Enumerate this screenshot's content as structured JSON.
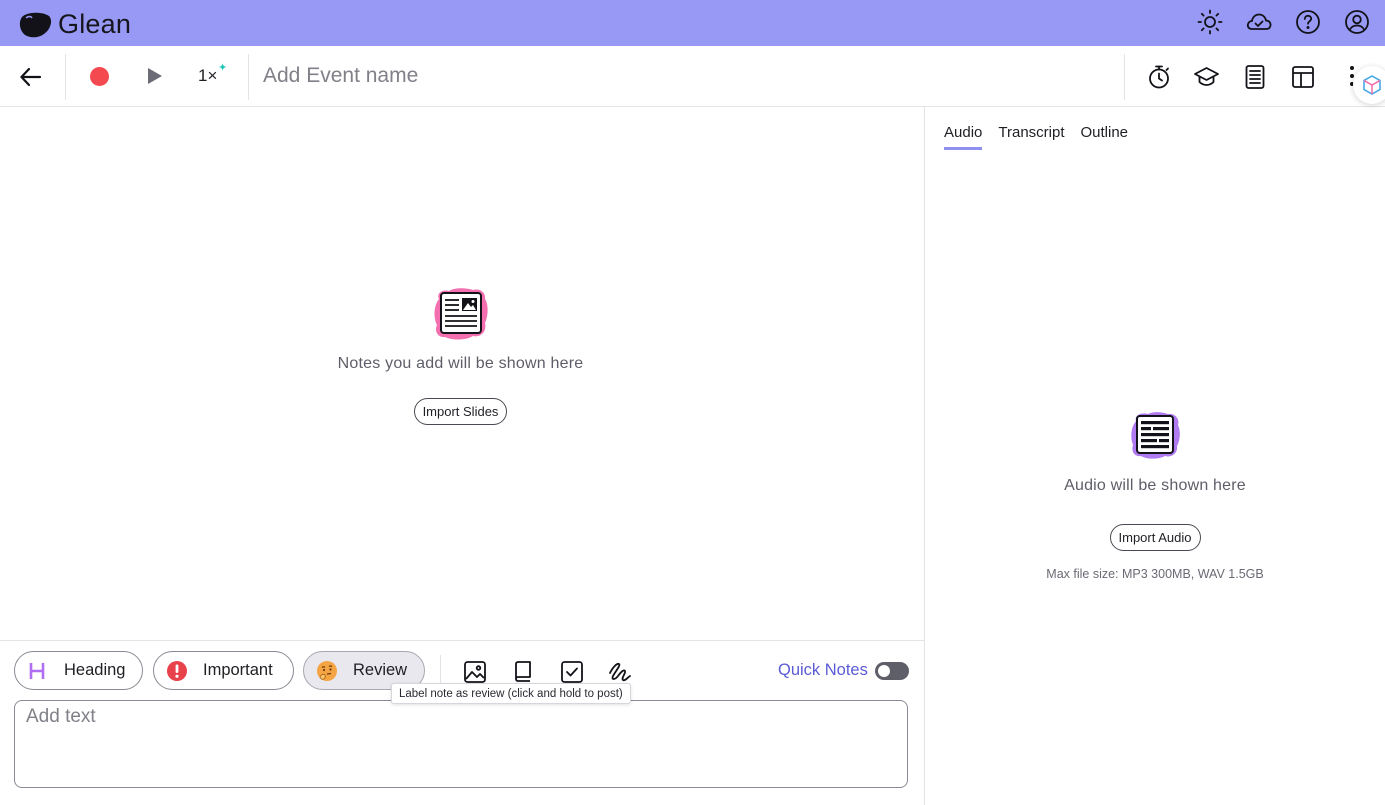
{
  "app": {
    "name": "Glean"
  },
  "topbar": {
    "icons": [
      "sun-icon",
      "cloud-icon",
      "help-icon",
      "account-icon"
    ]
  },
  "toolbar": {
    "speed": "1×",
    "event_placeholder": "Add Event name",
    "right_icons": [
      "timer-icon",
      "graduation-cap-icon",
      "document-icon",
      "layout-icon",
      "more-vertical-icon"
    ]
  },
  "notes": {
    "empty_text": "Notes you add will be shown here",
    "import_button": "Import Slides"
  },
  "side_panel": {
    "tabs": [
      {
        "label": "Audio",
        "active": true
      },
      {
        "label": "Transcript",
        "active": false
      },
      {
        "label": "Outline",
        "active": false
      }
    ],
    "empty_text": "Audio will be shown here",
    "import_button": "Import Audio",
    "max_size": "Max file size: MP3 300MB, WAV 1.5GB"
  },
  "compose": {
    "labels": [
      {
        "label": "Heading",
        "icon": "heading-icon"
      },
      {
        "label": "Important",
        "icon": "exclamation-icon"
      },
      {
        "label": "Review",
        "icon": "thinking-face-icon"
      }
    ],
    "tools": [
      "image-icon",
      "book-icon",
      "checkbox-icon",
      "scribble-icon"
    ],
    "quick_notes_label": "Quick Notes",
    "quick_notes_on": false,
    "tooltip": "Label note as review (click and hold to post)",
    "text_placeholder": "Add text"
  },
  "colors": {
    "topbar": "#9799f5",
    "record": "#f44a4f",
    "accent": "#5b5bd6",
    "tab_underline": "#8f8ff2"
  }
}
